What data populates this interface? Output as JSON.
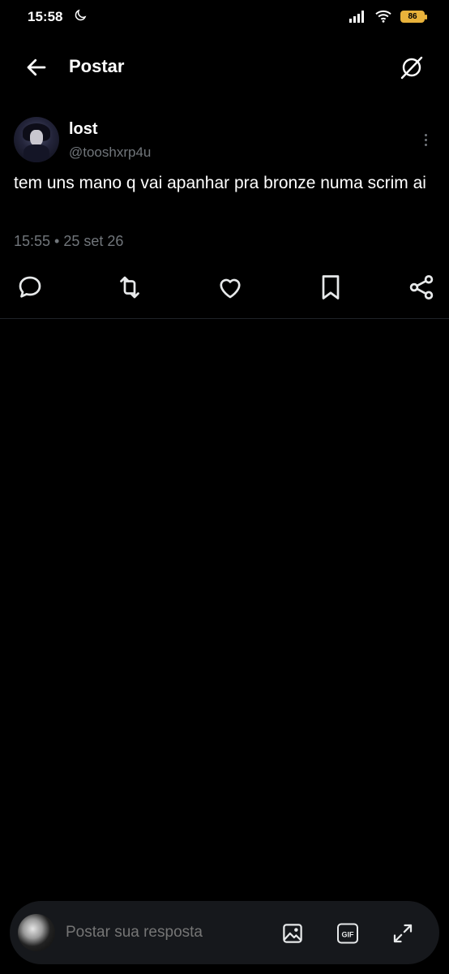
{
  "status_bar": {
    "time": "15:58",
    "battery": "86"
  },
  "header": {
    "title": "Postar"
  },
  "post": {
    "author_name": "lost",
    "author_handle": "@tooshxrp4u",
    "text": "tem uns mano q vai apanhar pra bronze numa scrim ai",
    "timestamp": "15:55 • 25 set 26"
  },
  "actions": [
    "reply-icon",
    "repost-icon",
    "like-icon",
    "bookmark-icon",
    "share-icon"
  ],
  "reply_bar": {
    "placeholder": "Postar sua resposta",
    "gif_label": "GIF"
  },
  "colors": {
    "background": "#000000",
    "text": "#e7e9ea",
    "muted": "#71767b",
    "reply_bar": "#16181c",
    "battery": "#e8b23b"
  }
}
